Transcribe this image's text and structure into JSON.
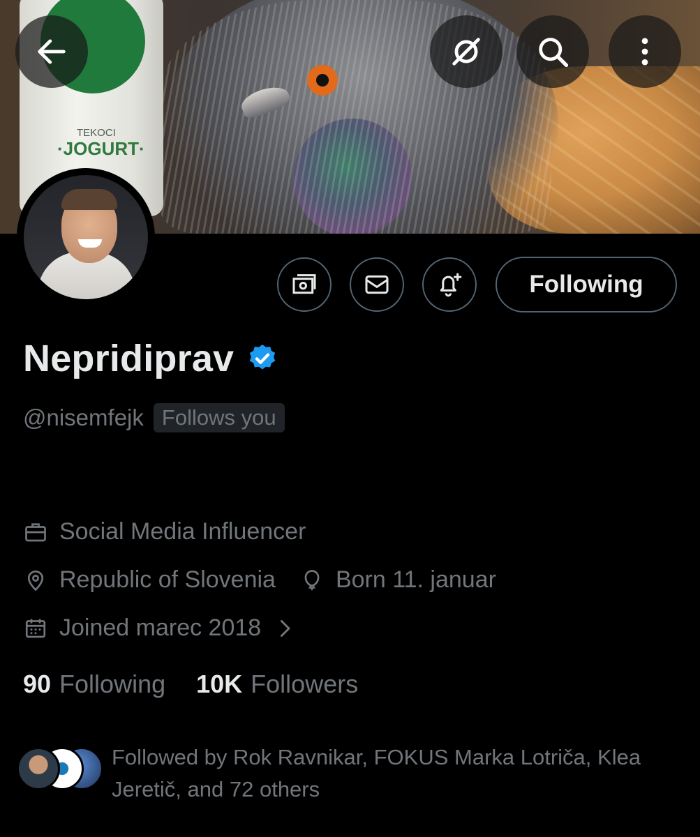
{
  "header": {
    "back_icon": "arrow-left-icon",
    "grok_icon": "grok-icon",
    "search_icon": "search-icon",
    "more_icon": "more-vertical-icon"
  },
  "banner": {
    "jar_small_text": "TEKOCI",
    "jar_big_text": "·JOGURT·"
  },
  "actions": {
    "subscribe_icon": "money-icon",
    "message_icon": "envelope-icon",
    "notify_icon": "bell-plus-icon",
    "follow_label": "Following"
  },
  "profile": {
    "display_name": "Nepridiprav",
    "verified_icon": "verified-badge-icon",
    "handle": "@nisemfejk",
    "follows_you": "Follows you",
    "category": "Social Media Influencer",
    "location": "Republic of Slovenia",
    "birthday": "Born 11. januar",
    "joined": "Joined marec 2018"
  },
  "stats": {
    "following_count": "90",
    "following_label": "Following",
    "followers_count": "10K",
    "followers_label": "Followers"
  },
  "followed_by": {
    "text": "Followed by Rok Ravnikar, FOKUS Marka Lotriča, Klea Jeretič, and 72 others"
  },
  "colors": {
    "background": "#000000",
    "primary_text": "#e7e9ea",
    "secondary_text": "#71767b",
    "border": "#536471",
    "verified_blue": "#1d9bf0"
  }
}
